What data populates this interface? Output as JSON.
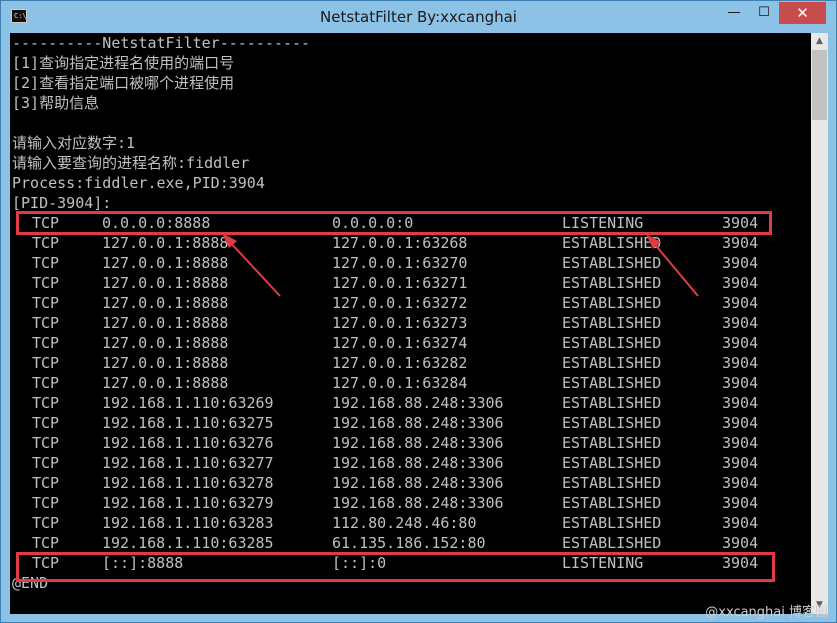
{
  "window": {
    "title": "NetstatFilter By:xxcanghai",
    "icon_label": "C:\\",
    "controls": {
      "minimize": "—",
      "maximize": "☐",
      "close": "✕"
    }
  },
  "console": {
    "lines": [
      "----------NetstatFilter----------",
      "[1]查询指定进程名使用的端口号",
      "[2]查看指定端口被哪个进程使用",
      "[3]帮助信息",
      "",
      "请输入对应数字:1",
      "请输入要查询的进程名称:fiddler",
      "Process:fiddler.exe,PID:3904",
      "[PID-3904]:"
    ],
    "rows": [
      {
        "proto": "TCP",
        "local": "0.0.0.0:8888",
        "remote": "0.0.0.0:0",
        "state": "LISTENING",
        "pid": "3904"
      },
      {
        "proto": "TCP",
        "local": "127.0.0.1:8888",
        "remote": "127.0.0.1:63268",
        "state": "ESTABLISHED",
        "pid": "3904"
      },
      {
        "proto": "TCP",
        "local": "127.0.0.1:8888",
        "remote": "127.0.0.1:63270",
        "state": "ESTABLISHED",
        "pid": "3904"
      },
      {
        "proto": "TCP",
        "local": "127.0.0.1:8888",
        "remote": "127.0.0.1:63271",
        "state": "ESTABLISHED",
        "pid": "3904"
      },
      {
        "proto": "TCP",
        "local": "127.0.0.1:8888",
        "remote": "127.0.0.1:63272",
        "state": "ESTABLISHED",
        "pid": "3904"
      },
      {
        "proto": "TCP",
        "local": "127.0.0.1:8888",
        "remote": "127.0.0.1:63273",
        "state": "ESTABLISHED",
        "pid": "3904"
      },
      {
        "proto": "TCP",
        "local": "127.0.0.1:8888",
        "remote": "127.0.0.1:63274",
        "state": "ESTABLISHED",
        "pid": "3904"
      },
      {
        "proto": "TCP",
        "local": "127.0.0.1:8888",
        "remote": "127.0.0.1:63282",
        "state": "ESTABLISHED",
        "pid": "3904"
      },
      {
        "proto": "TCP",
        "local": "127.0.0.1:8888",
        "remote": "127.0.0.1:63284",
        "state": "ESTABLISHED",
        "pid": "3904"
      },
      {
        "proto": "TCP",
        "local": "192.168.1.110:63269",
        "remote": "192.168.88.248:3306",
        "state": "ESTABLISHED",
        "pid": "3904"
      },
      {
        "proto": "TCP",
        "local": "192.168.1.110:63275",
        "remote": "192.168.88.248:3306",
        "state": "ESTABLISHED",
        "pid": "3904"
      },
      {
        "proto": "TCP",
        "local": "192.168.1.110:63276",
        "remote": "192.168.88.248:3306",
        "state": "ESTABLISHED",
        "pid": "3904"
      },
      {
        "proto": "TCP",
        "local": "192.168.1.110:63277",
        "remote": "192.168.88.248:3306",
        "state": "ESTABLISHED",
        "pid": "3904"
      },
      {
        "proto": "TCP",
        "local": "192.168.1.110:63278",
        "remote": "192.168.88.248:3306",
        "state": "ESTABLISHED",
        "pid": "3904"
      },
      {
        "proto": "TCP",
        "local": "192.168.1.110:63279",
        "remote": "192.168.88.248:3306",
        "state": "ESTABLISHED",
        "pid": "3904"
      },
      {
        "proto": "TCP",
        "local": "192.168.1.110:63283",
        "remote": "112.80.248.46:80",
        "state": "ESTABLISHED",
        "pid": "3904"
      },
      {
        "proto": "TCP",
        "local": "192.168.1.110:63285",
        "remote": "61.135.186.152:80",
        "state": "ESTABLISHED",
        "pid": "3904"
      },
      {
        "proto": "TCP",
        "local": "[::]:8888",
        "remote": "[::]:0",
        "state": "LISTENING",
        "pid": "3904"
      }
    ],
    "end_line": "@END"
  },
  "scrollbar": {
    "up_icon": "▲",
    "down_icon": "▼"
  },
  "watermark": "@xxcanghai 博客园",
  "colors": {
    "console_bg": "#000000",
    "console_text": "#c0c0c0",
    "highlight": "#e03a45",
    "titlebar": "#8cc2e6",
    "close_button": "#c74d4d"
  }
}
